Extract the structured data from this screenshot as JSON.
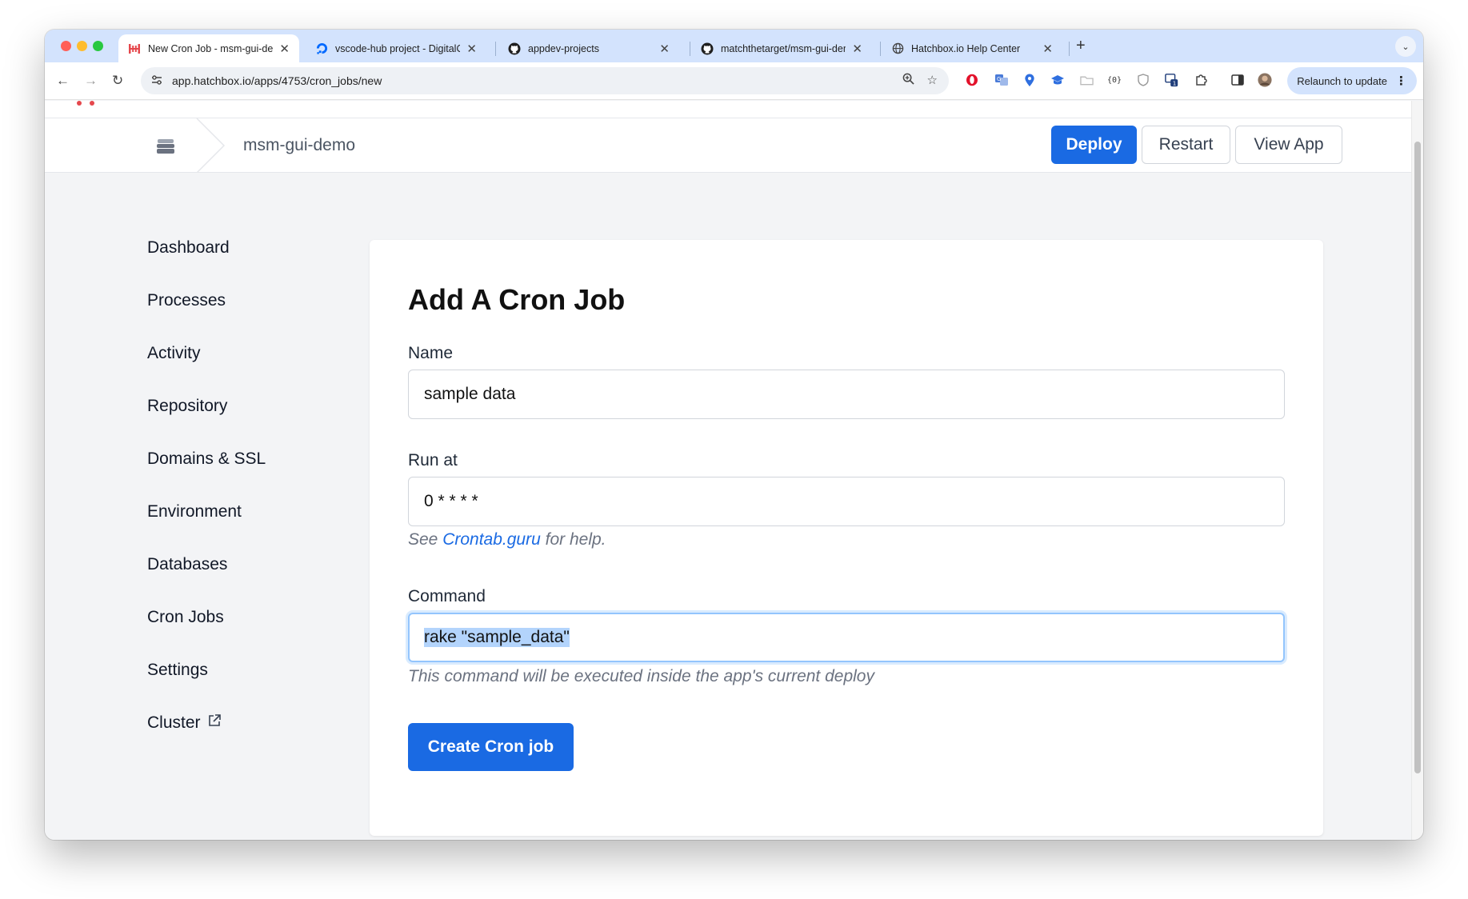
{
  "browser": {
    "tabs": [
      {
        "title": "New Cron Job - msm-gui-demo",
        "active": true,
        "icon": "hatchbox-icon"
      },
      {
        "title": "vscode-hub project - DigitalOcean",
        "active": false,
        "icon": "digitalocean-icon"
      },
      {
        "title": "appdev-projects",
        "active": false,
        "icon": "github-icon"
      },
      {
        "title": "matchthetarget/msm-gui-demo",
        "active": false,
        "icon": "github-icon"
      },
      {
        "title": "Hatchbox.io Help Center",
        "active": false,
        "icon": "globe-icon"
      }
    ],
    "new_tab_label": "+",
    "url": "app.hatchbox.io/apps/4753/cron_jobs/new",
    "relaunch_label": "Relaunch to update",
    "extension_badge": "1"
  },
  "header": {
    "app_name": "msm-gui-demo",
    "buttons": {
      "deploy": "Deploy",
      "restart": "Restart",
      "view_app": "View App"
    }
  },
  "sidebar": {
    "items": [
      {
        "label": "Dashboard"
      },
      {
        "label": "Processes"
      },
      {
        "label": "Activity"
      },
      {
        "label": "Repository"
      },
      {
        "label": "Domains & SSL"
      },
      {
        "label": "Environment"
      },
      {
        "label": "Databases"
      },
      {
        "label": "Cron Jobs"
      },
      {
        "label": "Settings"
      },
      {
        "label": "Cluster"
      }
    ]
  },
  "form": {
    "title": "Add A Cron Job",
    "name": {
      "label": "Name",
      "value": "sample data"
    },
    "run_at": {
      "label": "Run at",
      "value": "0 * * * *",
      "hint_prefix": "See ",
      "hint_link": "Crontab.guru",
      "hint_suffix": " for help."
    },
    "command": {
      "label": "Command",
      "value": "rake \"sample_data\"",
      "hint": "This command will be executed inside the app's current deploy"
    },
    "submit_label": "Create Cron job"
  },
  "colors": {
    "primary": "#1a6ae3",
    "tabstrip": "#d3e3fd",
    "page_background": "#f3f4f6"
  }
}
